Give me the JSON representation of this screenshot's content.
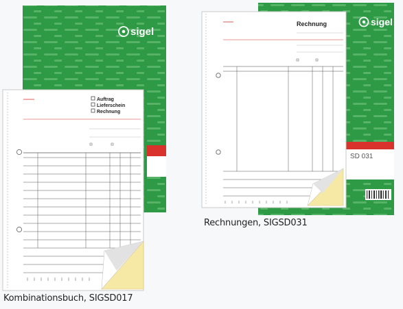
{
  "brand": {
    "logo": "sigel"
  },
  "products": [
    {
      "caption": "Kombinationsbuch, SIGSD017",
      "form_titles": [
        "Auftrag",
        "Lieferschein",
        "Rechnung"
      ]
    },
    {
      "caption": "Rechnungen, SIGSD031",
      "form_title": "Rechnung",
      "cover_code": "SD 031"
    }
  ],
  "colors": {
    "cover_green": "#2f9a45",
    "copy_yellow": "#f6e9a6",
    "accent_red": "#d9312b",
    "paper": "#ffffff"
  }
}
